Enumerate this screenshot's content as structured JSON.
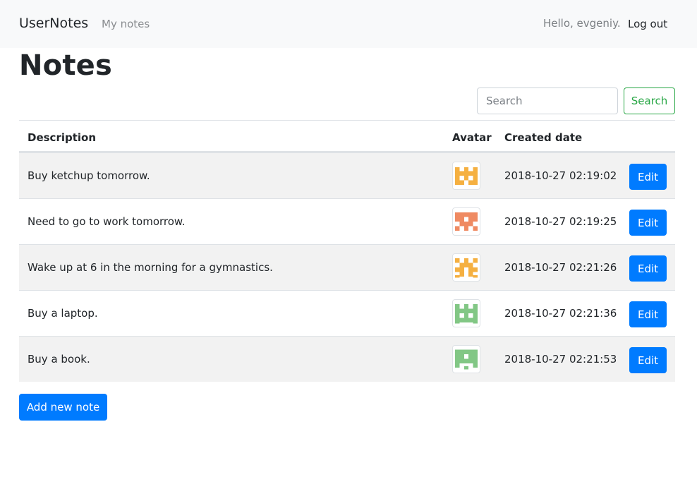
{
  "navbar": {
    "brand": "UserNotes",
    "my_notes": "My notes",
    "greeting": "Hello, evgeniy.",
    "logout": "Log out"
  },
  "page": {
    "title": "Notes"
  },
  "search": {
    "placeholder": "Search",
    "button_label": "Search"
  },
  "table": {
    "headers": {
      "description": "Description",
      "avatar": "Avatar",
      "created": "Created date"
    },
    "rows": [
      {
        "description": "Buy ketchup tomorrow.",
        "created": "2018-10-27 02:19:02",
        "edit_label": "Edit",
        "avatar_color": "#f5b041"
      },
      {
        "description": "Need to go to work tomorrow.",
        "created": "2018-10-27 02:19:25",
        "edit_label": "Edit",
        "avatar_color": "#ef8a62"
      },
      {
        "description": "Wake up at 6 in the morning for a gymnastics.",
        "created": "2018-10-27 02:21:26",
        "edit_label": "Edit",
        "avatar_color": "#f5b041"
      },
      {
        "description": "Buy a laptop.",
        "created": "2018-10-27 02:21:36",
        "edit_label": "Edit",
        "avatar_color": "#82c785"
      },
      {
        "description": "Buy a book.",
        "created": "2018-10-27 02:21:53",
        "edit_label": "Edit",
        "avatar_color": "#82c785"
      }
    ]
  },
  "add_button": {
    "label": "Add new note"
  },
  "colors": {
    "primary": "#007bff",
    "success": "#28a745",
    "navbar_bg": "#f8f9fa",
    "stripe": "#f2f2f2"
  }
}
